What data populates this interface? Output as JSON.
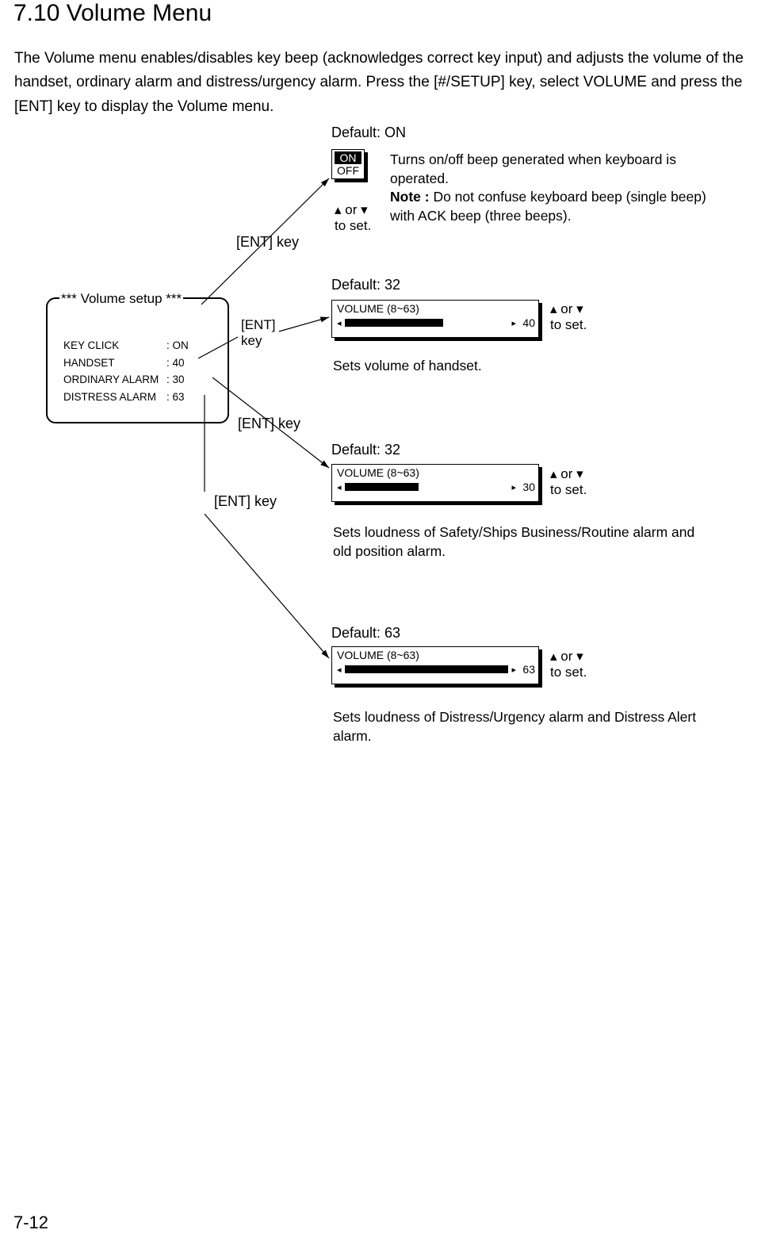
{
  "heading": "7.10    Volume Menu",
  "intro": "The Volume menu enables/disables key beep (acknowledges correct key input) and adjusts the volume of the handset, ordinary alarm and distress/urgency alarm. Press the [#/SETUP] key, select VOLUME and press the [ENT] key to display the Volume menu.",
  "page_number": "7-12",
  "setup": {
    "title": "*** Volume setup ***",
    "rows": [
      {
        "label": "KEY CLICK",
        "value": ": ON"
      },
      {
        "label": "HANDSET",
        "value": ": 40"
      },
      {
        "label": "ORDINARY ALARM",
        "value": ": 30"
      },
      {
        "label": "DISTRESS ALARM",
        "value": ": 63"
      }
    ]
  },
  "common": {
    "ent_key": "[ENT] key",
    "ent_key_stacked_1": "[ENT]",
    "ent_key_stacked_2": "key",
    "or_to_set_1": "▴ or ▾",
    "or_to_set_2": "to set.",
    "vol_label": "VOLUME (8~63)",
    "tri_l": "◂",
    "tri_r": "▸"
  },
  "keyclick": {
    "default": "Default: ON",
    "on": "ON",
    "off": "OFF",
    "desc_1": "Turns on/off beep generated when keyboard is operated.",
    "note_label": "Note :",
    "note_body": " Do not confuse keyboard beep (single beep) with ACK beep (three beeps)."
  },
  "handset": {
    "default": "Default: 32",
    "value": "40",
    "fill_pct": "60%",
    "desc": "Sets volume of handset."
  },
  "ordinary": {
    "default": "Default: 32",
    "value": "30",
    "fill_pct": "45%",
    "desc": "Sets loudness of Safety/Ships Business/Routine alarm and old position alarm."
  },
  "distress": {
    "default": "Default: 63",
    "value": "63",
    "fill_pct": "100%",
    "desc": "Sets loudness of Distress/Urgency alarm and Distress Alert alarm."
  }
}
